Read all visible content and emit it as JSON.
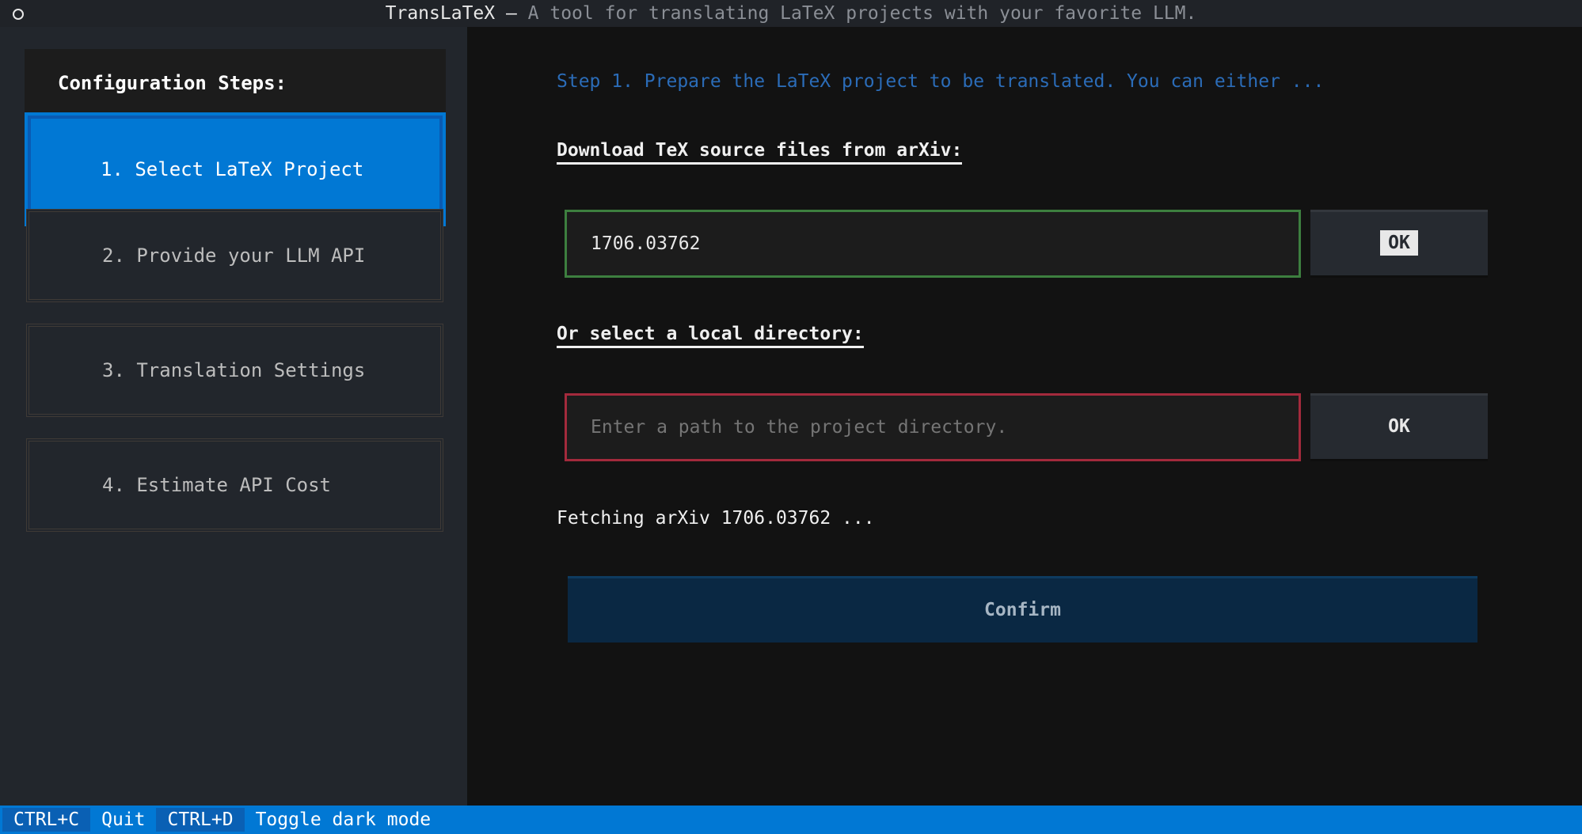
{
  "window": {
    "title": "TransLaTeX",
    "separator": " — ",
    "subtitle": "A tool for translating LaTeX projects with your favorite LLM."
  },
  "sidebar": {
    "header": "Configuration Steps:",
    "steps": [
      {
        "label": "1. Select LaTeX Project",
        "active": true
      },
      {
        "label": "2. Provide your LLM API",
        "active": false
      },
      {
        "label": "3. Translation Settings",
        "active": false
      },
      {
        "label": "4. Estimate API Cost",
        "active": false
      }
    ]
  },
  "main": {
    "step_description": "Step 1. Prepare the LaTeX project to be translated. You can either  ...",
    "arxiv_section": {
      "label": "Download TeX source files from arXiv:",
      "input_value": "1706.03762",
      "ok_label": "OK"
    },
    "local_section": {
      "label": "Or select a local directory:",
      "input_value": "",
      "input_placeholder": "Enter a path to the project directory.",
      "ok_label": "OK"
    },
    "status": "Fetching arXiv 1706.03762 ...",
    "confirm_label": "Confirm"
  },
  "footer": {
    "bindings": [
      {
        "key": "CTRL+C",
        "label": "Quit"
      },
      {
        "key": "CTRL+D",
        "label": "Toggle dark mode"
      }
    ]
  },
  "colors": {
    "accent": "#0178d4",
    "valid_border": "#3d7f3f",
    "invalid_border": "#a32a3c",
    "step_description": "#2b6cb8"
  }
}
